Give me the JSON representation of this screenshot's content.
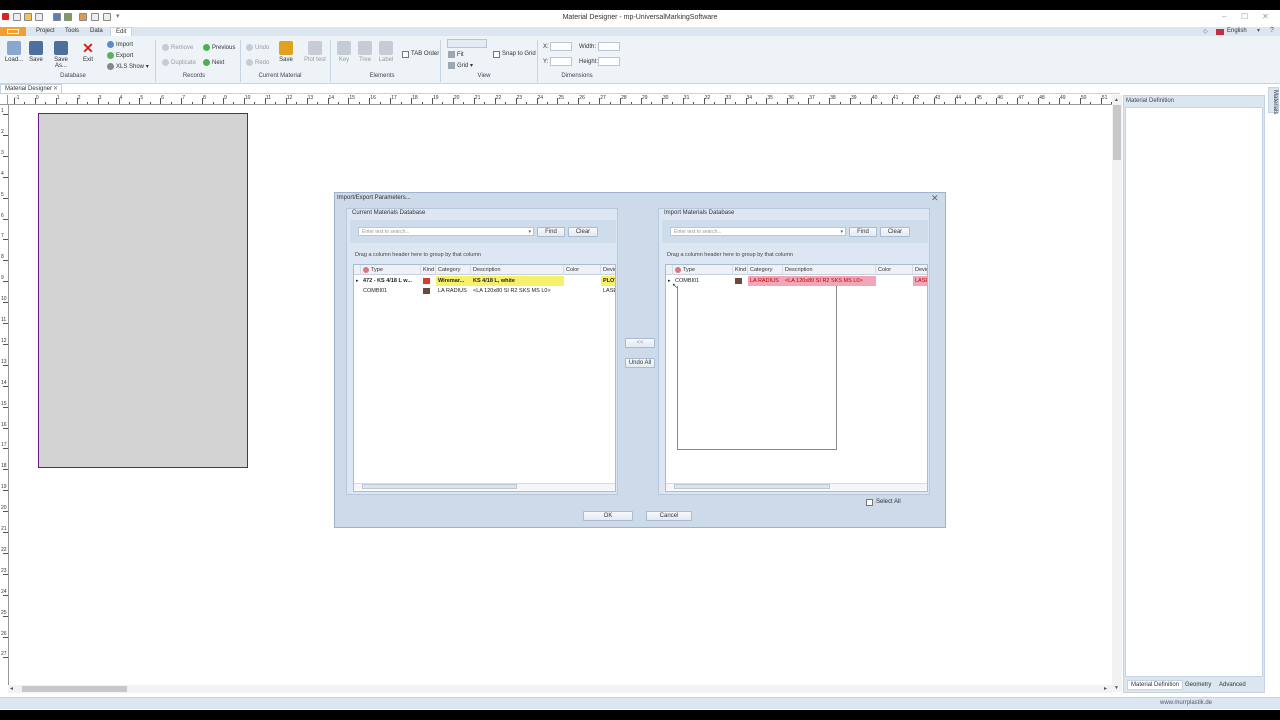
{
  "app": {
    "title": "Material Designer - mp-UniversalMarkingSoftware",
    "site": "www.murrplastik.de",
    "language": "English"
  },
  "menu": {
    "items": [
      "Project",
      "Tools",
      "Data",
      "Edit"
    ]
  },
  "ribbon": {
    "database": {
      "label": "Database",
      "load": "Load...",
      "save": "Save",
      "save_as": "Save As...",
      "exit": "Exit",
      "import": "Import",
      "export": "Export",
      "xls_show": "XLS Show"
    },
    "records": {
      "label": "Records",
      "remove": "Remove",
      "duplicate": "Duplicate",
      "previous": "Previous",
      "next": "Next"
    },
    "current_material": {
      "label": "Current Material",
      "undo": "Undo",
      "redo": "Redo",
      "save": "Save",
      "plot_test": "Plot test"
    },
    "elements": {
      "label": "Elements",
      "key": "Key",
      "tree": "Tree",
      "label_btn": "Label",
      "tab_order": "TAB Order"
    },
    "view": {
      "label": "View",
      "fit": "Fit",
      "grid": "Grid",
      "snap_to_grid": "Snap to Grid"
    },
    "dimensions": {
      "label": "Dimensions",
      "x": "X:",
      "y": "Y:",
      "width": "Width:",
      "height": "Height:"
    }
  },
  "document": {
    "tab": "Material Designer"
  },
  "ruler": {
    "h_labels": [
      "-1",
      "0",
      "1",
      "2",
      "3",
      "4",
      "5",
      "6",
      "7",
      "8",
      "9",
      "10",
      "11",
      "12",
      "13",
      "14",
      "15",
      "16",
      "17",
      "18",
      "19",
      "20",
      "21",
      "22",
      "23",
      "24",
      "25",
      "26",
      "27",
      "28",
      "29",
      "30",
      "31",
      "32",
      "33",
      "34",
      "35",
      "36",
      "37",
      "38",
      "39",
      "40",
      "41",
      "42",
      "43",
      "44",
      "45",
      "46",
      "47",
      "48",
      "49",
      "50",
      "51"
    ],
    "v_labels": [
      "1",
      "2",
      "3",
      "4",
      "5",
      "6",
      "7",
      "8",
      "9",
      "10",
      "11",
      "12",
      "13",
      "14",
      "15",
      "16",
      "17",
      "18",
      "19",
      "20",
      "21",
      "22",
      "23",
      "24",
      "25",
      "26",
      "27"
    ]
  },
  "right_panel": {
    "title": "Material Definition",
    "side_tab": "Materials",
    "tabs": [
      "Material Definition",
      "Geometry",
      "Advanced"
    ]
  },
  "dialog": {
    "title": "Import/Export Parameters...",
    "current": {
      "title": "Current Materials Database",
      "search_placeholder": "Enter text to search...",
      "find": "Find",
      "clear": "Clear",
      "group_hint": "Drag a column header here to group by that column",
      "columns": [
        "Type",
        "Kind",
        "Category",
        "Description",
        "Color",
        "Devic"
      ],
      "rows": [
        {
          "type": "472 - KS 4/18 L w...",
          "category": "Wiremar...",
          "description": "KS 4/18 L, white",
          "color": "",
          "device": "PLOT"
        },
        {
          "type": "COMBI01",
          "category": "LA RADIUS",
          "description": "<LA 120x80 SI R2 SKS MS L0>",
          "color": "",
          "device": "LASE"
        }
      ]
    },
    "import": {
      "title": "Import Materials Database",
      "search_placeholder": "Enter text to search...",
      "find": "Find",
      "clear": "Clear",
      "group_hint": "Drag a column header here to group by that column",
      "columns": [
        "Type",
        "Kind",
        "Category",
        "Description",
        "Color",
        "Devic"
      ],
      "rows": [
        {
          "type": "COMBI01",
          "category": "LA RADIUS",
          "description": "<LA 120x80 SI R2 SKS MS L0>",
          "color": "",
          "device": "LASE"
        }
      ]
    },
    "transfer_btn": "<<",
    "undo_all": "Undo All",
    "select_all": "Select All",
    "ok": "OK",
    "cancel": "Cancel"
  },
  "colors": {
    "highlight_yellow": "#f7f06a",
    "highlight_pink": "#f2a6b8",
    "sheet_border": "#6a1a8a",
    "file_tab": "#f0a030"
  }
}
